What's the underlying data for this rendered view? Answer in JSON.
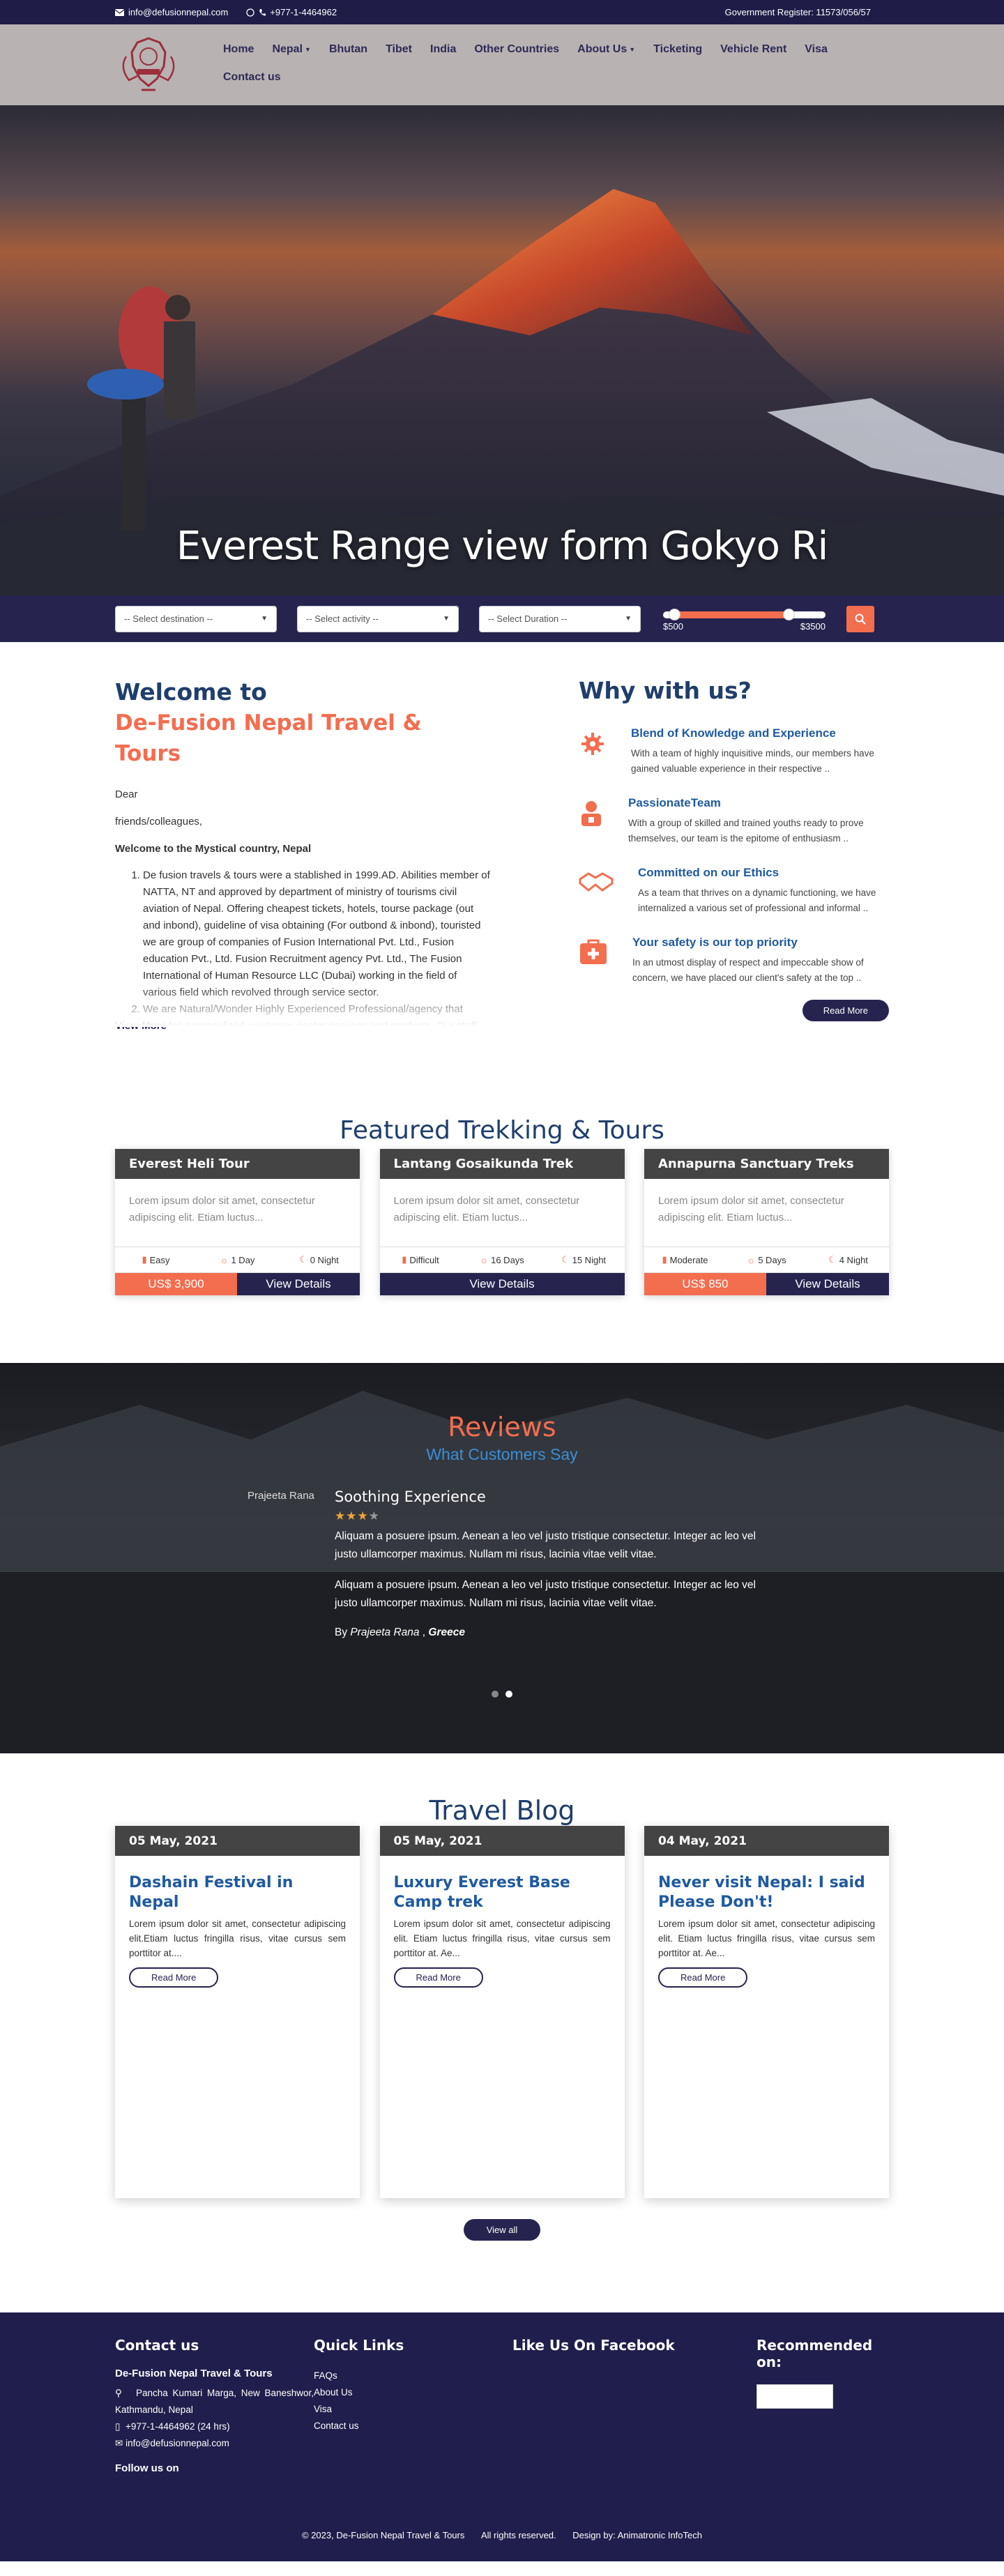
{
  "topbar": {
    "email": "info@defusionnepal.com",
    "phone": "+977-1-4464962",
    "register": "Government Register: 11573/056/57"
  },
  "nav": {
    "items": [
      {
        "label": "Home"
      },
      {
        "label": "Nepal"
      },
      {
        "label": "Bhutan"
      },
      {
        "label": "Tibet"
      },
      {
        "label": "India"
      },
      {
        "label": "Other Countries"
      },
      {
        "label": "About Us"
      },
      {
        "label": "Ticketing"
      },
      {
        "label": "Vehicle Rent"
      },
      {
        "label": "Visa"
      },
      {
        "label": "Contact us"
      }
    ]
  },
  "hero": {
    "title": "Everest Range view form Gokyo Ri"
  },
  "search": {
    "destination": "-- Select destination --",
    "activity": "-- Select activity --",
    "duration": "-- Select Duration --",
    "price_min": "$500",
    "price_max": "$3500"
  },
  "welcome": {
    "title1": "Welcome to",
    "title2": "De-Fusion Nepal Travel & Tours",
    "dear": "Dear",
    "friends": "friends/colleagues,",
    "bold": "Welcome to the Mystical country, Nepal",
    "li1": "De fusion travels & tours were a stablished in 1999.AD. Abilities member of NATTA, NT and approved by department of ministry of tourisms civil aviation of Nepal. Offering cheapest tickets, hotels, tourse package (out and inbond), guideline of visa obtaining (For outbond & inbond), touristed we are group of companies of Fusion International Pvt. Ltd., Fusion education Pvt., Ltd. Fusion Recruitment agency Pvt. Ltd., The Fusion International of Human Resource LLC (Dubai) working in the field of various field which revolved through service sector.",
    "li2": "We are Natural/Wonder Highly Experienced Professional/agency that provides personalized, customer-center services and products. Our staff are experts in their field and some of them have been in the tourism field for over two decades. They are also pioneers in guiding travelers to such exotic destinations like India, Bhutan, Tibet, Mustang,",
    "view_more": "View More"
  },
  "why": {
    "title": "Why with us?",
    "items": [
      {
        "title": "Blend of Knowledge and Experience",
        "text": "With a team of highly inquisitive minds, our members have gained valuable experience in their respective .."
      },
      {
        "title": "PassionateTeam",
        "text": "With a group of skilled and trained youths ready to prove themselves, our team is the epitome of enthusiasm .."
      },
      {
        "title": "Committed on our Ethics",
        "text": "As a team that thrives on a dynamic functioning, we have internalized a various set of professional and informal .."
      },
      {
        "title": "Your safety is our top priority",
        "text": "In an utmost display of respect and impeccable show of concern, we have placed our client's safety at the top .."
      }
    ],
    "read_more": "Read More"
  },
  "featured": {
    "title": "Featured Trekking & Tours",
    "cards": [
      {
        "title": "Everest Heli Tour",
        "text": "Lorem ipsum dolor sit amet, consectetur adipiscing elit. Etiam luctus...",
        "grade": "Easy",
        "days": "1 Day",
        "nights": "0 Night",
        "price": "US$ 3,900",
        "btn": "View Details"
      },
      {
        "title": "Lantang Gosaikunda Trek",
        "text": "Lorem ipsum dolor sit amet, consectetur adipiscing elit. Etiam luctus...",
        "grade": "Difficult",
        "days": "16 Days",
        "nights": "15 Night",
        "price": "",
        "btn": "View Details"
      },
      {
        "title": "Annapurna Sanctuary Treks",
        "text": "Lorem ipsum dolor sit amet, consectetur adipiscing elit. Etiam luctus...",
        "grade": "Moderate",
        "days": "5 Days",
        "nights": "4 Night",
        "price": "US$ 850",
        "btn": "View Details"
      }
    ]
  },
  "reviews": {
    "title": "Reviews",
    "subtitle": "What Customers Say",
    "avatar_alt": "Prajeeta Rana",
    "heading": "Soothing Experience",
    "rating": 3,
    "p1": "Aliquam a posuere ipsum. Aenean a leo vel justo tristique consectetur. Integer ac leo vel justo ullamcorper maximus. Nullam mi risus, lacinia vitae velit vitae.",
    "p2": "Aliquam a posuere ipsum. Aenean a leo vel justo tristique consectetur. Integer ac leo vel justo ullamcorper maximus. Nullam mi risus, lacinia vitae velit vitae.",
    "by": "By",
    "author": "Prajeeta Rana",
    "country": "Greece"
  },
  "blog": {
    "title": "Travel Blog",
    "posts": [
      {
        "date": "05 May, 2021",
        "title": "Dashain Festival in Nepal",
        "text": "Lorem ipsum dolor sit amet, consectetur adipiscing elit.Etiam luctus fringilla risus, vitae cursus sem porttitor at....",
        "btn": "Read More"
      },
      {
        "date": "05 May, 2021",
        "title": "Luxury Everest Base Camp trek",
        "text": "Lorem ipsum dolor sit amet, consectetur adipiscing elit. Etiam luctus fringilla risus, vitae cursus sem porttitor at. Ae...",
        "btn": "Read More"
      },
      {
        "date": "04 May, 2021",
        "title": "Never visit Nepal: I said Please Don't!",
        "text": "Lorem ipsum dolor sit amet, consectetur adipiscing elit. Etiam luctus fringilla risus, vitae cursus sem porttitor at. Ae...",
        "btn": "Read More"
      }
    ],
    "view_all": "View all"
  },
  "footer": {
    "contact_title": "Contact us",
    "company": "De-Fusion Nepal Travel & Tours",
    "address": "Pancha Kumari Marga, New Baneshwor, Kathmandu, Nepal",
    "phone": "+977-1-4464962 (24 hrs)",
    "email": "info@defusionnepal.com",
    "follow": "Follow us on",
    "links_title": "Quick Links",
    "links": [
      "FAQs",
      "About Us",
      "Visa",
      "Contact us"
    ],
    "fb_title": "Like Us On Facebook",
    "rec_title": "Recommended on:",
    "copyright": "© 2023, De-Fusion Nepal Travel & Tours",
    "rights": "All rights reserved.",
    "design": "Design by: Animatronic InfoTech"
  },
  "colors": {
    "navy": "#1f1d48",
    "accent": "#f36d4f",
    "heading": "#1f3e6d"
  }
}
